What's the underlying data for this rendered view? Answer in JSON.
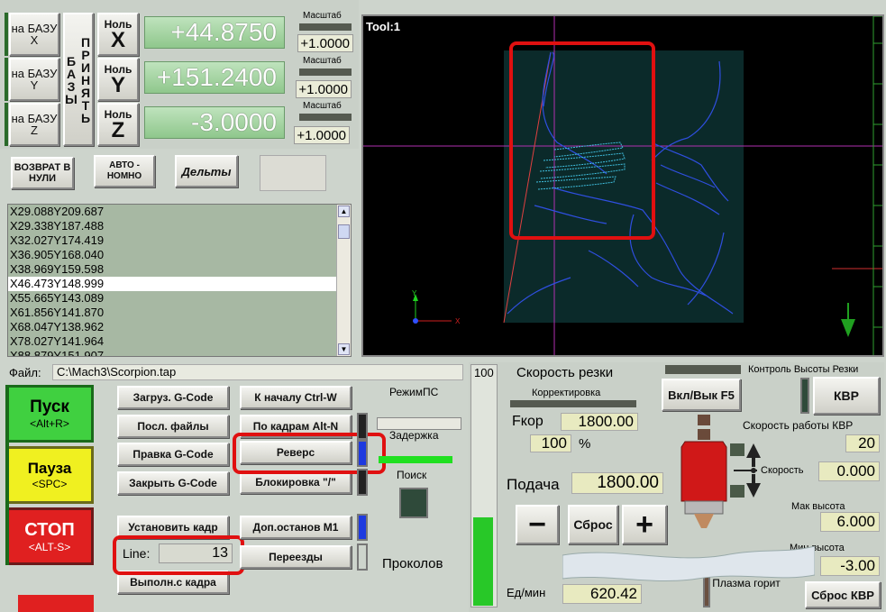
{
  "axes": [
    {
      "id": "x",
      "home_label": "на БАЗУ X",
      "zero_label": "Ноль X",
      "zero_letter": "X",
      "value": "+44.8750",
      "scale_label": "Масштаб",
      "scale_value": "+1.0000"
    },
    {
      "id": "y",
      "home_label": "на БАЗУ Y",
      "zero_label": "Ноль Y",
      "zero_letter": "Y",
      "value": "+151.2400",
      "scale_label": "Масштаб",
      "scale_value": "+1.0000"
    },
    {
      "id": "z",
      "home_label": "на БАЗУ Z",
      "zero_label": "Ноль Z",
      "zero_letter": "Z",
      "value": "-3.0000",
      "scale_label": "Масштаб",
      "scale_value": "+1.0000"
    }
  ],
  "accept_bases_label": "ПРИНЯТЬ БАЗЫ",
  "return_zero_label": "ВОЗВРАТ В НУЛИ",
  "auto_label": "АВТО - НОМНО",
  "deltas_label": "Дельты",
  "toolpath": {
    "title": "Tool:1"
  },
  "gcode_lines": [
    "X29.088Y209.687",
    "X29.338Y187.488",
    "X32.027Y174.419",
    "X36.905Y168.040",
    "X38.969Y159.598",
    "X46.473Y148.999",
    "X55.665Y143.089",
    "X61.856Y141.870",
    "X68.047Y138.962",
    "X78.027Y141.964",
    "X88.879Y151.907"
  ],
  "gcode_selected_index": 5,
  "file": {
    "label": "Файл:",
    "path": "C:\\Mach3\\Scorpion.tap"
  },
  "run": {
    "start_label": "Пуск",
    "start_key": "<Alt+R>",
    "pause_label": "Пауза",
    "pause_key": "<SPC>",
    "stop_label": "СТОП",
    "stop_key": "<ALT-S>"
  },
  "file_buttons": {
    "load": "Загруз. G-Code",
    "recent": "Посл. файлы",
    "edit": "Правка G-Code",
    "close": "Закрыть G-Code",
    "set_frame": "Установить кадр",
    "run_from": "Выполн.с кадра"
  },
  "run_buttons": {
    "rewind": "К началу Ctrl-W",
    "single": "По кадрам Alt-N",
    "reverse": "Реверс",
    "block_skip": "Блокировка \"/\"",
    "opt_stop": "Доп.останов M1",
    "rapids": "Переезды"
  },
  "line": {
    "label": "Line:",
    "value": "13"
  },
  "mode_labels": {
    "mode": "РежимПС",
    "delay": "Задержка",
    "search": "Поиск",
    "pierces": "Проколов"
  },
  "feed": {
    "slider_value": "100",
    "title": "Скорость резки",
    "correction": "Корректировка",
    "fkor_label": "Fкор",
    "fkor_value": "1800.00",
    "percent_value": "100",
    "percent_sign": "%",
    "feed_label": "Подача",
    "feed_value": "1800.00",
    "minus": "−",
    "reset": "Сброс",
    "plus": "+",
    "units_label": "Ед/мин",
    "units_value": "620.42"
  },
  "thc": {
    "title": "Контроль Высоты Резки",
    "onoff": "Вкл/Вык F5",
    "kvr": "КВР",
    "speed_title": "Скорость работы КВР",
    "speed_value": "20",
    "speed_label": "Скорость",
    "current_value": "0.000",
    "max_label": "Мак высота",
    "max_value": "6.000",
    "min_label": "Мин высота",
    "min_value": "-3.00",
    "plasma_label": "Плазма горит",
    "reset_kvr": "Сброс КВР"
  }
}
